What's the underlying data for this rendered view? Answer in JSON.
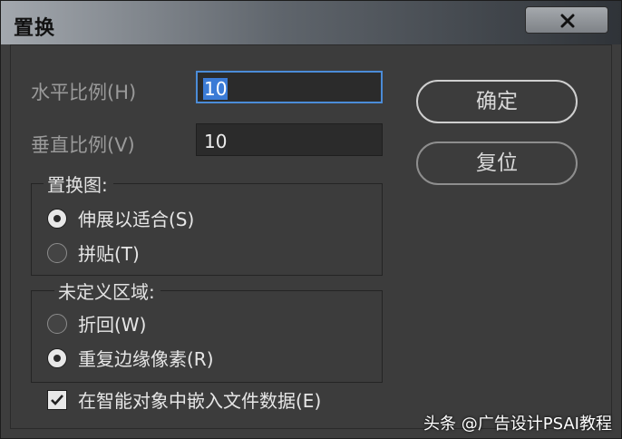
{
  "window": {
    "title": "置换",
    "close_glyph": "✕"
  },
  "fields": {
    "horizontal_label": "水平比例(H)",
    "horizontal_value": "10",
    "vertical_label": "垂直比例(V)",
    "vertical_value": "10"
  },
  "buttons": {
    "ok": "确定",
    "reset": "复位"
  },
  "displacement_map": {
    "title": "置换图:",
    "options": [
      {
        "label": "伸展以适合(S)",
        "selected": true
      },
      {
        "label": "拼贴(T)",
        "selected": false
      }
    ]
  },
  "undefined_areas": {
    "title": "未定义区域:",
    "options": [
      {
        "label": "折回(W)",
        "selected": false
      },
      {
        "label": "重复边缘像素(R)",
        "selected": true
      }
    ]
  },
  "embed": {
    "label": "在智能对象中嵌入文件数据(E)",
    "checked": true
  },
  "watermark": "头条 @广告设计PSAI教程"
}
